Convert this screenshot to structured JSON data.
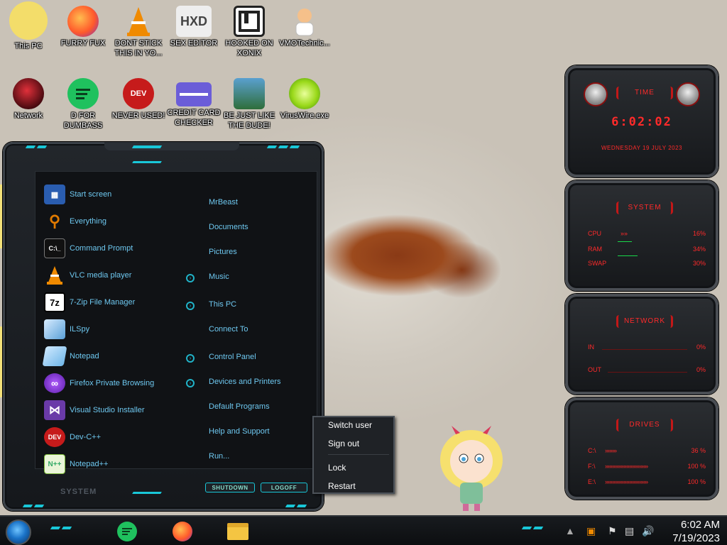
{
  "desktop": {
    "icons": [
      {
        "label": "This PC",
        "icon": "cartoon-girl-icon"
      },
      {
        "label": "FURRY FUX",
        "icon": "firefox-icon"
      },
      {
        "label": "DONT STICK\nTHIS IN YO...",
        "icon": "vlc-cone-icon"
      },
      {
        "label": "SEX EDITOR",
        "icon": "hxd-icon"
      },
      {
        "label": "HOOKED ON\nXONIX",
        "icon": "xonix-icon"
      },
      {
        "label": "VMOTechnic...",
        "icon": "doctor-icon"
      },
      {
        "label": "Network",
        "icon": "red-orb-icon"
      },
      {
        "label": "D FOR\nDUMBASS",
        "icon": "green-chat-icon"
      },
      {
        "label": "NEVER USED!",
        "icon": "dev-cpp-icon"
      },
      {
        "label": "CREDIT CARD\nCHECKER",
        "icon": "credit-card-icon"
      },
      {
        "label": "BE JUST LIKE\nTHE DUDE!",
        "icon": "elf-icon"
      },
      {
        "label": "VirusWire.exe",
        "icon": "lime-icon"
      }
    ]
  },
  "start_menu": {
    "programs": [
      {
        "label": "Start screen",
        "icon": "start-screen-icon",
        "color": "#2a5db0"
      },
      {
        "label": "Everything",
        "icon": "magnifier-icon",
        "color": "#e07a00"
      },
      {
        "label": "Command Prompt",
        "icon": "cmd-icon",
        "color": "#111111"
      },
      {
        "label": "VLC media player",
        "icon": "vlc-icon",
        "color": "#e88a00"
      },
      {
        "label": "7-Zip File Manager",
        "icon": "7zip-icon",
        "color": "#ffffff"
      },
      {
        "label": "ILSpy",
        "icon": "ilspy-icon",
        "color": "#5aa0d8"
      },
      {
        "label": "Notepad",
        "icon": "notepad-icon",
        "color": "#6fb6e8"
      },
      {
        "label": "Firefox Private Browsing",
        "icon": "firefox-private-icon",
        "color": "#6b2bb8"
      },
      {
        "label": "Visual Studio Installer",
        "icon": "visual-studio-icon",
        "color": "#6a3aa8"
      },
      {
        "label": "Dev-C++",
        "icon": "dev-cpp-icon",
        "color": "#c61b1b"
      },
      {
        "label": "Notepad++",
        "icon": "notepadpp-icon",
        "color": "#7dbb3a"
      }
    ],
    "places": [
      {
        "label": "MrBeast",
        "arrow": false
      },
      {
        "label": "Documents",
        "arrow": false
      },
      {
        "label": "Pictures",
        "arrow": false
      },
      {
        "label": "Music",
        "arrow": true
      },
      {
        "label": "This PC",
        "arrow": true
      },
      {
        "label": "Connect To",
        "arrow": false
      },
      {
        "label": "Control Panel",
        "arrow": true
      },
      {
        "label": "Devices and Printers",
        "arrow": true
      },
      {
        "label": "Default Programs",
        "arrow": false
      },
      {
        "label": "Help and Support",
        "arrow": false
      },
      {
        "label": "Run...",
        "arrow": false
      }
    ],
    "shutdown_label": "SHUTDOWN",
    "logoff_label": "LOGOFF",
    "system_label": "SYSTEM"
  },
  "power_menu": {
    "items": [
      "Switch user",
      "Sign out",
      "Lock",
      "Restart"
    ]
  },
  "gadgets": {
    "time": {
      "title": "TIME",
      "clock": "6:02:02",
      "date": "WEDNESDAY 19 JULY 2023"
    },
    "system": {
      "title": "SYSTEM",
      "rows": [
        {
          "key": "CPU",
          "value": "16%"
        },
        {
          "key": "RAM",
          "value": "34%"
        },
        {
          "key": "SWAP",
          "value": "30%"
        }
      ]
    },
    "network": {
      "title": "NETWORK",
      "rows": [
        {
          "key": "IN",
          "value": "0%"
        },
        {
          "key": "OUT",
          "value": "0%"
        }
      ]
    },
    "drives": {
      "title": "DRIVES",
      "rows": [
        {
          "key": "C:\\",
          "value": "36 %"
        },
        {
          "key": "F:\\",
          "value": "100 %"
        },
        {
          "key": "E:\\",
          "value": "100 %"
        }
      ]
    }
  },
  "taskbar": {
    "apps": [
      "green-chat-icon",
      "firefox-icon",
      "file-explorer-icon"
    ],
    "time": "6:02 AM",
    "date": "7/19/2023",
    "accent": "#19c7d8"
  }
}
